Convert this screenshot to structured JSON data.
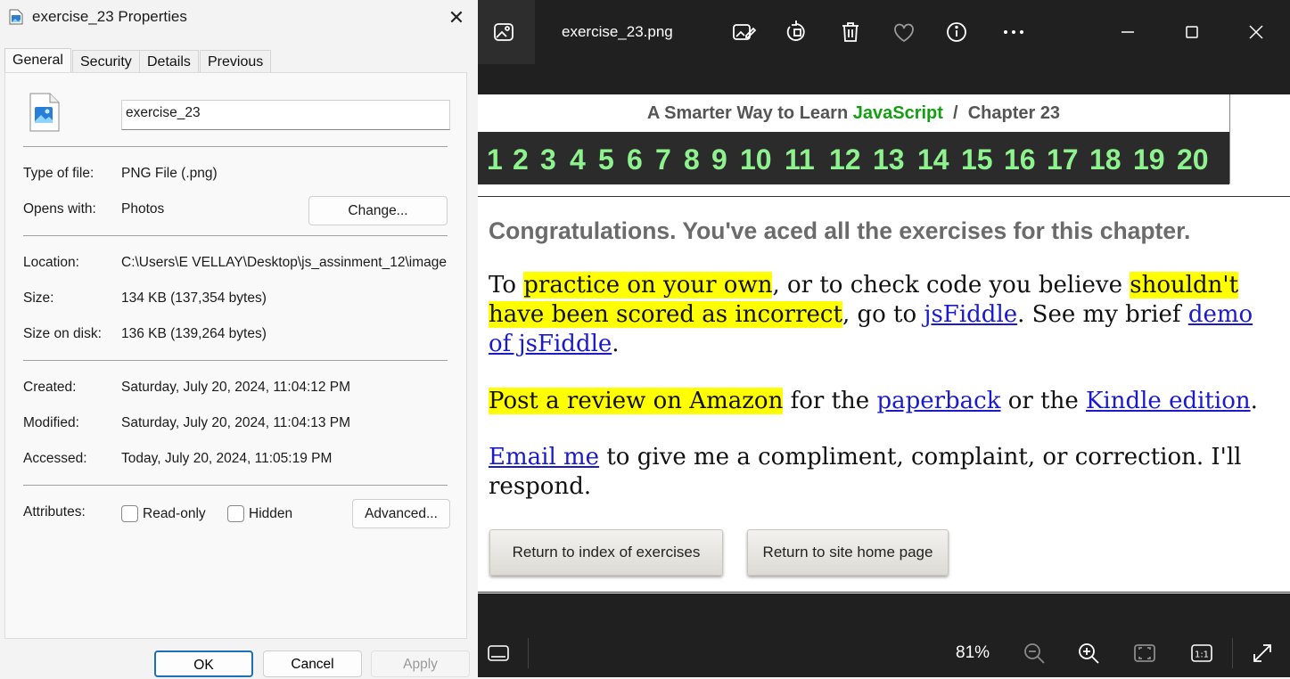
{
  "properties": {
    "title": "exercise_23 Properties",
    "close_glyph": "✕",
    "tabs": [
      "General",
      "Security",
      "Details",
      "Previous Versions"
    ],
    "filename": "exercise_23",
    "type_label": "Type of file:",
    "type_value": "PNG File (.png)",
    "opens_label": "Opens with:",
    "opens_value": "Photos",
    "change_button": "Change...",
    "location_label": "Location:",
    "location_value": "C:\\Users\\E VELLAY\\Desktop\\js_assinment_12\\image",
    "size_label": "Size:",
    "size_value": "134 KB (137,354 bytes)",
    "size_disk_label": "Size on disk:",
    "size_disk_value": "136 KB (139,264 bytes)",
    "created_label": "Created:",
    "created_value": "Saturday, July 20, 2024, 11:04:12 PM",
    "modified_label": "Modified:",
    "modified_value": "Saturday, July 20, 2024, 11:04:13 PM",
    "accessed_label": "Accessed:",
    "accessed_value": "Today, July 20, 2024, 11:05:19 PM",
    "attributes_label": "Attributes:",
    "readonly_label": "Read-only",
    "hidden_label": "Hidden",
    "advanced_button": "Advanced...",
    "ok_button": "OK",
    "cancel_button": "Cancel",
    "apply_button": "Apply"
  },
  "viewer": {
    "file_title": "exercise_23.png",
    "zoom": "81%",
    "accent": "#202020"
  },
  "page": {
    "head_prefix": "A Smarter Way to Learn ",
    "head_js": "JavaScript",
    "head_suffix": "  /  Chapter 23",
    "chapters": [
      "1",
      "2",
      "3",
      "4",
      "5",
      "6",
      "7",
      "8",
      "9",
      "10",
      "11",
      "12",
      "13",
      "14",
      "15",
      "16",
      "17",
      "18",
      "19",
      "20"
    ],
    "congrats": "Congratulations. You've aced all the exercises for this chapter.",
    "p1_a": "To ",
    "p1_hl1": "practice on your own",
    "p1_b": ", or to check code you believe ",
    "p1_hl2": "shouldn't have been scored as incorrect",
    "p1_c": ", go to ",
    "p1_link1": "jsFiddle",
    "p1_d": ". See my brief ",
    "p1_link2": "demo of jsFiddle",
    "p1_e": ".",
    "p2_hl": "Post a review on Amazon",
    "p2_a": " for the ",
    "p2_link1": "paperback",
    "p2_b": " or the ",
    "p2_link2": "Kindle edition",
    "p2_c": ".",
    "p3_link": "Email me",
    "p3_a": " to give me a compliment, complaint, or correction. I'll respond.",
    "btn_index": "Return to index of exercises",
    "btn_home": "Return to site home page"
  }
}
